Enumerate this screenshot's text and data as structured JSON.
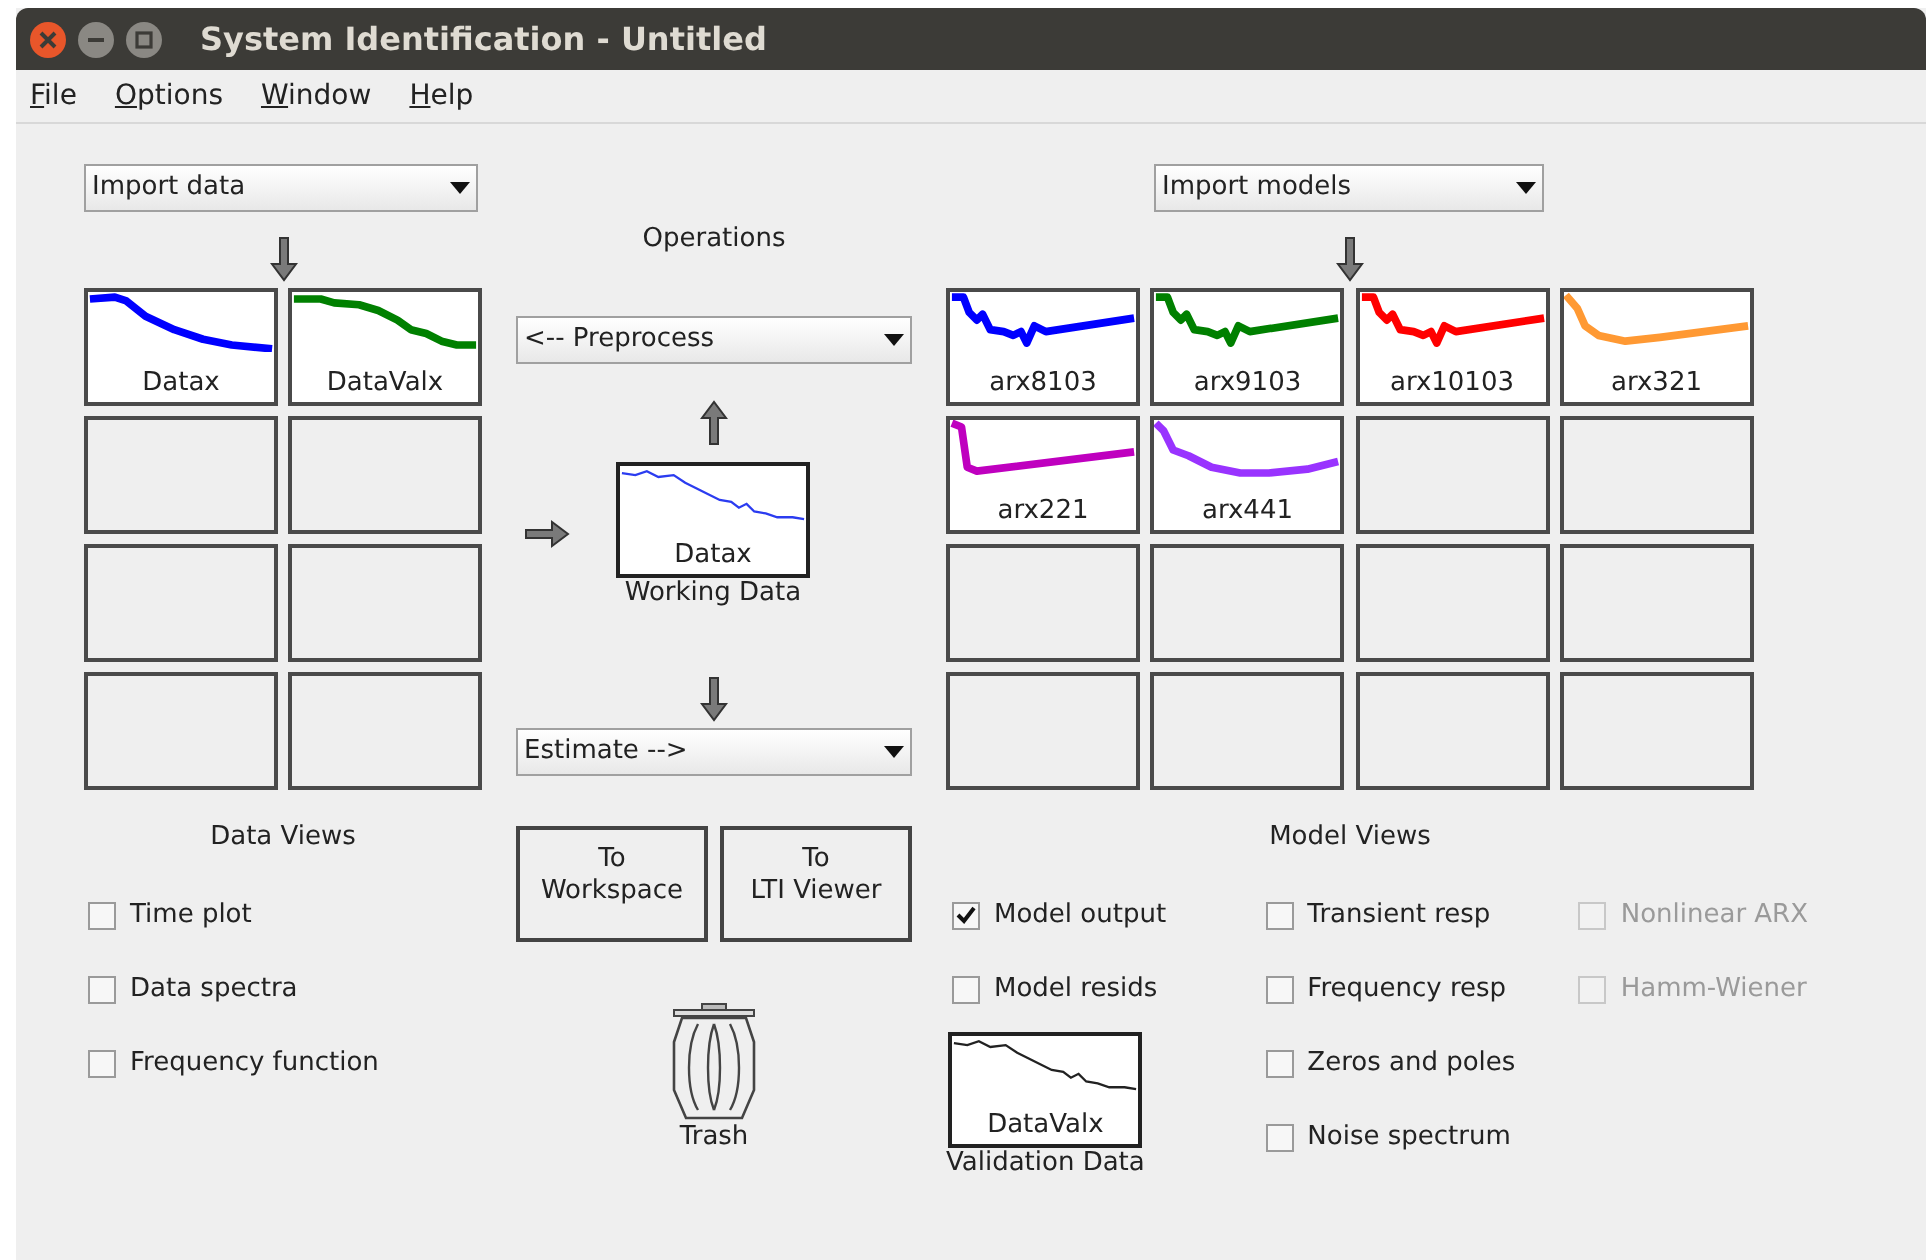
{
  "window": {
    "title": "System Identification - Untitled"
  },
  "menu": [
    {
      "label": "File"
    },
    {
      "label": "Options"
    },
    {
      "label": "Window"
    },
    {
      "label": "Help"
    }
  ],
  "data_import": {
    "label": "Import data"
  },
  "data_sets": [
    {
      "name": "Datax",
      "color": "#0000ff",
      "kind": "decay"
    },
    {
      "name": "DataValx",
      "color": "#008000",
      "kind": "noisy"
    }
  ],
  "operations": {
    "title": "Operations",
    "preprocess": "<-- Preprocess",
    "working_data": {
      "name": "Datax",
      "caption": "Working Data"
    },
    "estimate": "Estimate -->"
  },
  "buttons": [
    {
      "label": "To\nWorkspace"
    },
    {
      "label": "To\nLTI Viewer"
    }
  ],
  "trash": {
    "label": "Trash"
  },
  "data_views": {
    "title": "Data Views",
    "options": [
      {
        "label": "Time plot",
        "checked": false
      },
      {
        "label": "Data spectra",
        "checked": false
      },
      {
        "label": "Frequency function",
        "checked": false
      }
    ]
  },
  "model_import": {
    "label": "Import models"
  },
  "models": [
    {
      "name": "arx8103",
      "color": "#0000ff",
      "kind": "wiggly"
    },
    {
      "name": "arx9103",
      "color": "#008000",
      "kind": "wiggly"
    },
    {
      "name": "arx10103",
      "color": "#ff0000",
      "kind": "wiggly"
    },
    {
      "name": "arx321",
      "color": "#ff9933",
      "kind": "knee"
    },
    {
      "name": "arx221",
      "color": "#bf00bf",
      "kind": "step"
    },
    {
      "name": "arx441",
      "color": "#9933ff",
      "kind": "bowl"
    }
  ],
  "model_views": {
    "title": "Model Views",
    "columns": [
      {
        "options": [
          {
            "label": "Model output",
            "checked": true,
            "disabled": false
          },
          {
            "label": "Model resids",
            "checked": false,
            "disabled": false
          }
        ]
      },
      {
        "options": [
          {
            "label": "Transient resp",
            "checked": false,
            "disabled": false
          },
          {
            "label": "Frequency resp",
            "checked": false,
            "disabled": false
          },
          {
            "label": "Zeros and poles",
            "checked": false,
            "disabled": false
          },
          {
            "label": "Noise spectrum",
            "checked": false,
            "disabled": false
          }
        ]
      },
      {
        "options": [
          {
            "label": "Nonlinear ARX",
            "checked": false,
            "disabled": true
          },
          {
            "label": "Hamm-Wiener",
            "checked": false,
            "disabled": true
          }
        ]
      }
    ]
  },
  "validation_data": {
    "name": "DataValx",
    "caption": "Validation Data"
  }
}
